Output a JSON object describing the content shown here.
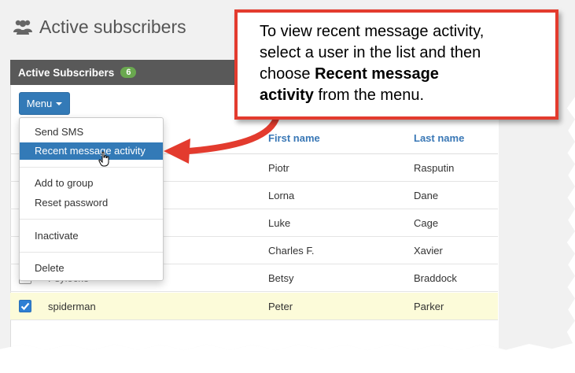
{
  "page": {
    "title": "Active subscribers",
    "icon": "users-icon"
  },
  "panel": {
    "header_label": "Active Subscribers",
    "count": "6"
  },
  "menu_button": {
    "label": "Menu"
  },
  "dropdown": {
    "items": [
      {
        "label": "Send SMS"
      },
      {
        "label": "Recent message activity",
        "active": true
      },
      {
        "label": "Add to group"
      },
      {
        "label": "Reset password"
      },
      {
        "label": "Inactivate"
      },
      {
        "label": "Delete"
      }
    ]
  },
  "table": {
    "columns": [
      "First name",
      "Last name"
    ],
    "rows": [
      {
        "username": "",
        "first": "Piotr",
        "last": "Rasputin",
        "checked": false
      },
      {
        "username": "",
        "first": "Lorna",
        "last": "Dane",
        "checked": false
      },
      {
        "username": "",
        "first": "Luke",
        "last": "Cage",
        "checked": false
      },
      {
        "username": "",
        "first": "Charles F.",
        "last": "Xavier",
        "checked": false
      },
      {
        "username": "Psylocke",
        "first": "Betsy",
        "last": "Braddock",
        "checked": false
      },
      {
        "username": "spiderman",
        "first": "Peter",
        "last": "Parker",
        "checked": true
      }
    ]
  },
  "callout": {
    "line1": "To view recent message activity,",
    "line2": "select a user in the list and then",
    "line3_pre": "choose ",
    "line3_bold": "Recent message",
    "line4_bold": "activity",
    "line4_post": " from the menu."
  },
  "colors": {
    "accent": "#337ab7",
    "callout_border": "#e33b2e",
    "badge": "#6aa84f",
    "selected_row": "#fcfbd9"
  }
}
